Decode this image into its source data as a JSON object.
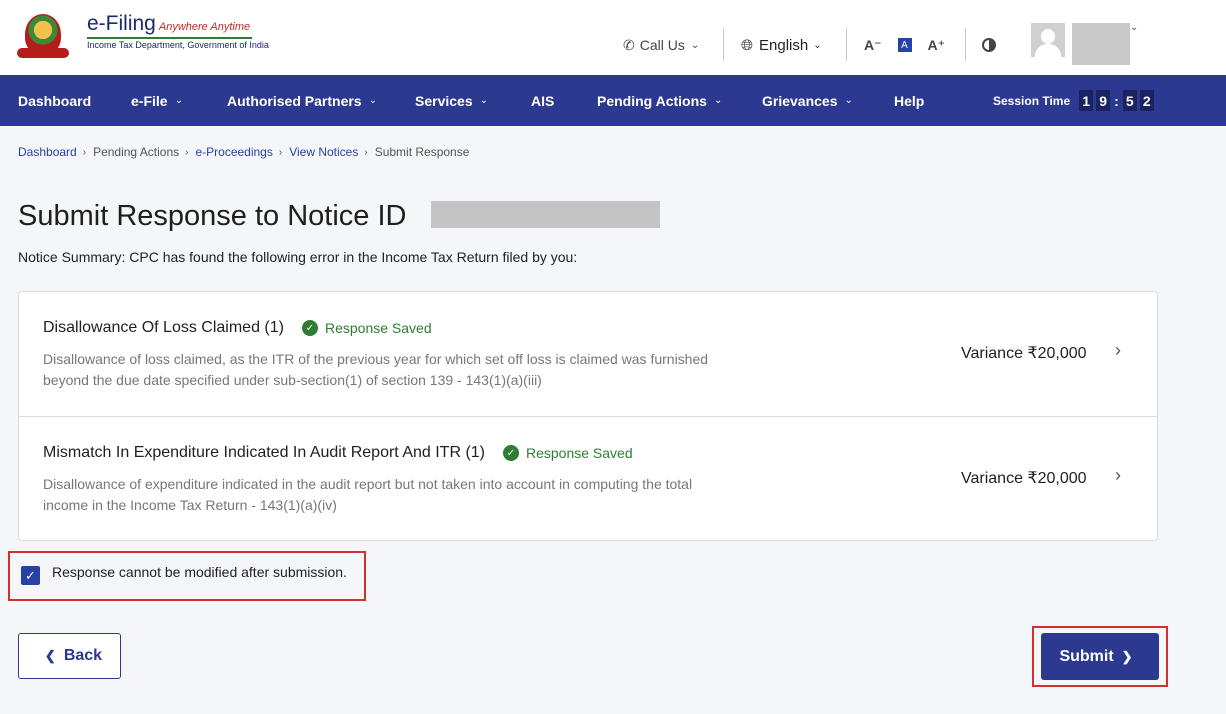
{
  "header": {
    "logo_main": "e-Filing",
    "logo_tagline": "Anywhere Anytime",
    "logo_sub": "Income Tax Department, Government of India",
    "call_us": "Call Us",
    "language": "English",
    "font_decrease": "A⁻",
    "font_default": "A",
    "font_increase": "A⁺"
  },
  "nav": {
    "items": [
      {
        "label": "Dashboard"
      },
      {
        "label": "e-File"
      },
      {
        "label": "Authorised Partners"
      },
      {
        "label": "Services"
      },
      {
        "label": "AIS"
      },
      {
        "label": "Pending Actions"
      },
      {
        "label": "Grievances"
      },
      {
        "label": "Help"
      }
    ],
    "session_label": "Session Time",
    "session_digits": [
      "1",
      "9",
      "5",
      "2"
    ]
  },
  "breadcrumb": {
    "items": [
      "Dashboard",
      "Pending Actions",
      "e-Proceedings",
      "View Notices",
      "Submit Response"
    ]
  },
  "main": {
    "title": "Submit Response to Notice ID",
    "summary": "Notice Summary: CPC has found the following error in the Income Tax Return filed by you:",
    "cards": [
      {
        "title": "Disallowance Of Loss Claimed (1)",
        "status": "Response Saved",
        "desc_line1": "Disallowance of loss claimed, as the ITR of the previous year for which set off loss is claimed was furnished",
        "desc_line2": "beyond the due date specified under sub-section(1) of section 139 - 143(1)(a)(iii)",
        "variance": "Variance ₹20,000"
      },
      {
        "title": "Mismatch In Expenditure Indicated In Audit Report And ITR (1)",
        "status": "Response Saved",
        "desc_line1": "Disallowance of expenditure indicated in the audit report but not taken into account in computing the total",
        "desc_line2": "income in the Income Tax Return - 143(1)(a)(iv)",
        "variance": "Variance ₹20,000"
      }
    ],
    "ack_label": "Response cannot be modified after submission.",
    "back_label": "Back",
    "submit_label": "Submit"
  },
  "colors": {
    "brand": "#2b3990",
    "success": "#2e7d32",
    "highlight": "#d32f2f"
  }
}
